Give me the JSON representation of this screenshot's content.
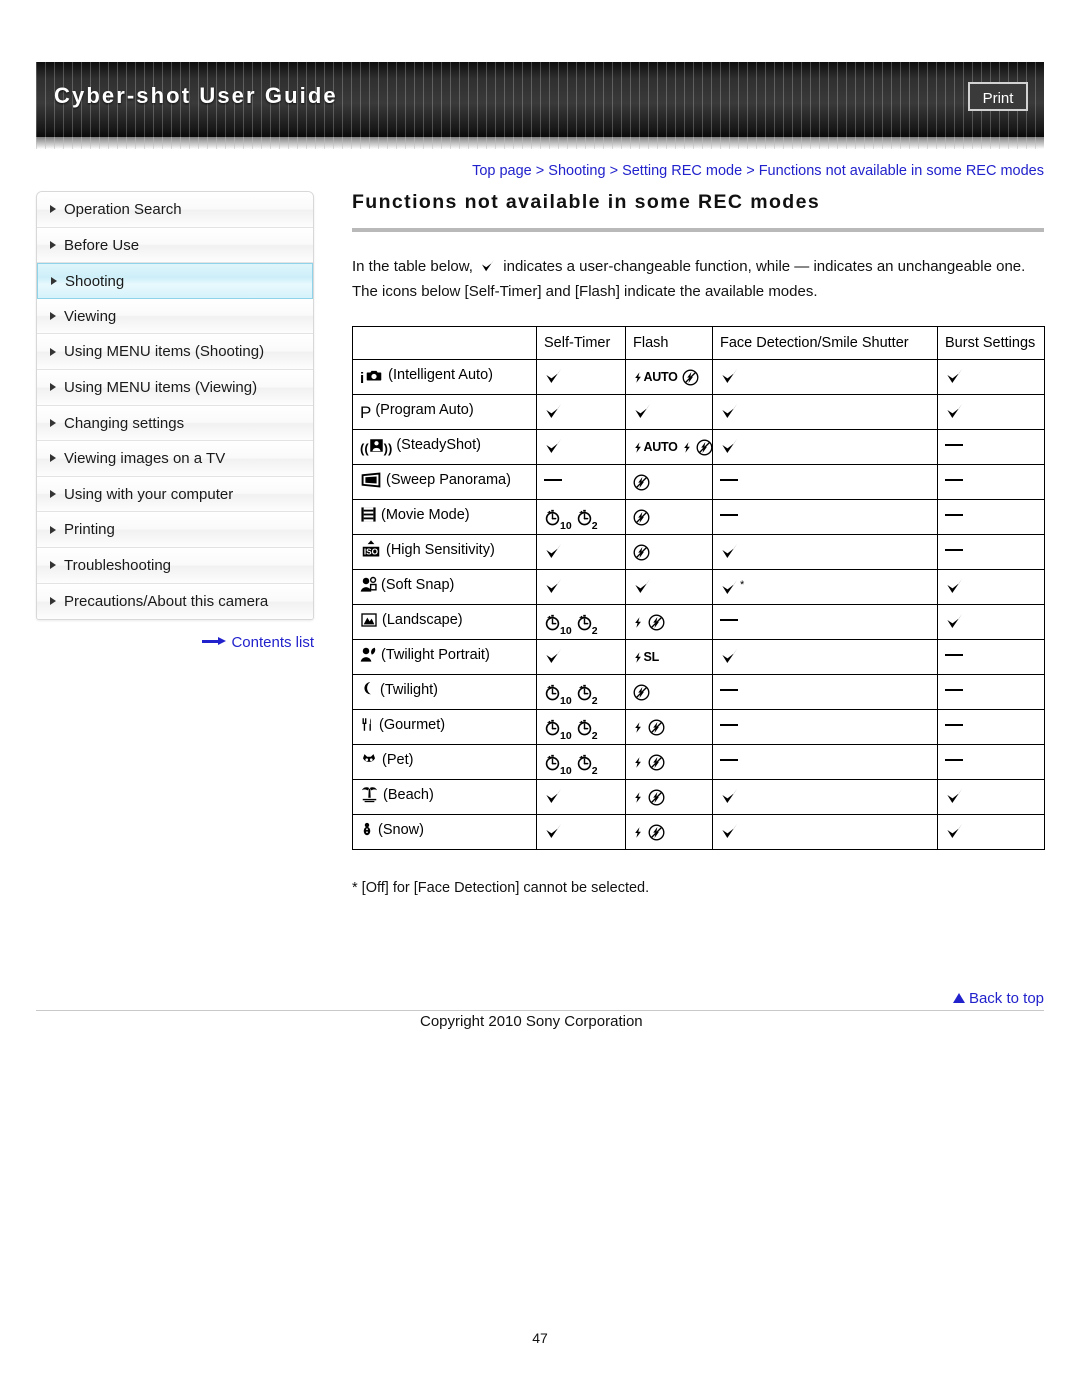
{
  "header": {
    "title": "Cyber-shot User Guide",
    "print_label": "Print"
  },
  "breadcrumb": {
    "items": [
      "Top page",
      "Shooting",
      "Setting REC mode",
      "Functions not available in some REC modes"
    ],
    "separator": ">"
  },
  "sidebar": {
    "items": [
      {
        "label": "Operation Search",
        "active": false
      },
      {
        "label": "Before Use",
        "active": false
      },
      {
        "label": "Shooting",
        "active": true
      },
      {
        "label": "Viewing",
        "active": false
      },
      {
        "label": "Using MENU items (Shooting)",
        "active": false
      },
      {
        "label": "Using MENU items (Viewing)",
        "active": false
      },
      {
        "label": "Changing settings",
        "active": false
      },
      {
        "label": "Viewing images on a TV",
        "active": false
      },
      {
        "label": "Using with your computer",
        "active": false
      },
      {
        "label": "Printing",
        "active": false
      },
      {
        "label": "Troubleshooting",
        "active": false
      },
      {
        "label": "Precautions/About this camera",
        "active": false
      }
    ],
    "contents_link": "Contents list"
  },
  "main": {
    "title": "Functions not available in some REC modes",
    "intro_part1": "In the table below,",
    "intro_part2": "indicates a user-changeable function, while — indicates an unchangeable one. The icons below [Self-Timer] and [Flash] indicate the available modes.",
    "footnote": "* [Off] for [Face Detection] cannot be selected."
  },
  "table": {
    "headers": [
      "",
      "Self-Timer",
      "Flash",
      "Face Detection/Smile Shutter",
      "Burst Settings"
    ],
    "rows": [
      {
        "icon": "intelligent-auto-icon",
        "label": "(Intelligent Auto)",
        "self_timer": "check",
        "flash": "flash-auto-off",
        "face": "check",
        "burst": "check"
      },
      {
        "icon": "program-auto-icon",
        "label": "(Program Auto)",
        "self_timer": "check",
        "flash": "check",
        "face": "check",
        "burst": "check"
      },
      {
        "icon": "steadyshot-icon",
        "label": "(SteadyShot)",
        "self_timer": "check",
        "flash": "flash-auto-on-off",
        "face": "check",
        "burst": "dash"
      },
      {
        "icon": "sweep-panorama-icon",
        "label": "(Sweep Panorama)",
        "self_timer": "dash",
        "flash": "flash-off",
        "face": "dash",
        "burst": "dash"
      },
      {
        "icon": "movie-mode-icon",
        "label": "(Movie Mode)",
        "self_timer": "timer-10-2",
        "flash": "flash-off",
        "face": "dash",
        "burst": "dash"
      },
      {
        "icon": "high-sensitivity-icon",
        "label": "(High Sensitivity)",
        "self_timer": "check",
        "flash": "flash-off",
        "face": "check",
        "burst": "dash"
      },
      {
        "icon": "soft-snap-icon",
        "label": "(Soft Snap)",
        "self_timer": "check",
        "flash": "check",
        "face": "check-star",
        "burst": "check"
      },
      {
        "icon": "landscape-icon",
        "label": "(Landscape)",
        "self_timer": "timer-10-2",
        "flash": "flash-on-off",
        "face": "dash",
        "burst": "check"
      },
      {
        "icon": "twilight-portrait-icon",
        "label": "(Twilight Portrait)",
        "self_timer": "check",
        "flash": "flash-slow-sync",
        "face": "check",
        "burst": "dash"
      },
      {
        "icon": "twilight-icon",
        "label": "(Twilight)",
        "self_timer": "timer-10-2",
        "flash": "flash-off",
        "face": "dash",
        "burst": "dash"
      },
      {
        "icon": "gourmet-icon",
        "label": "(Gourmet)",
        "self_timer": "timer-10-2",
        "flash": "flash-on-off",
        "face": "dash",
        "burst": "dash"
      },
      {
        "icon": "pet-icon",
        "label": "(Pet)",
        "self_timer": "timer-10-2",
        "flash": "flash-on-off",
        "face": "dash",
        "burst": "dash"
      },
      {
        "icon": "beach-icon",
        "label": "(Beach)",
        "self_timer": "check",
        "flash": "flash-on-off",
        "face": "check",
        "burst": "check"
      },
      {
        "icon": "snow-icon",
        "label": "(Snow)",
        "self_timer": "check",
        "flash": "flash-on-off",
        "face": "check",
        "burst": "check"
      }
    ]
  },
  "footer": {
    "back_to_top": "Back to top",
    "copyright": "Copyright 2010 Sony Corporation",
    "page_number": "47"
  },
  "colors": {
    "link": "#2222cc",
    "active_nav": "#cdeff9",
    "banner": "#2f2f2f"
  }
}
